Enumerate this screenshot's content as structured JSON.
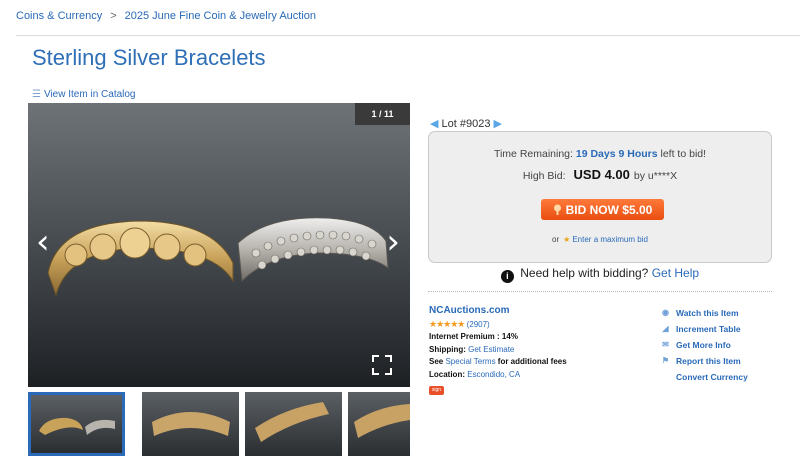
{
  "breadcrumb": {
    "items": [
      "Coins & Currency",
      "2025 June Fine Coin & Jewelry Auction"
    ],
    "separator": ">"
  },
  "title": "Sterling Silver Bracelets",
  "catalog_link": "View Item in Catalog",
  "gallery": {
    "counter": "1 / 11",
    "thumbnail_count": 4
  },
  "lot": {
    "label": "Lot #9023"
  },
  "bid": {
    "time_label": "Time Remaining:",
    "time_value": "19 Days 9 Hours",
    "time_suffix": "left to bid!",
    "high_label": "High Bid:",
    "high_amount": "USD 4.00",
    "high_by": "by u****X",
    "button_label": "BID NOW $5.00",
    "max_prefix": "or",
    "max_link": "Enter a maximum bid"
  },
  "help": {
    "text": "Need help with bidding?",
    "link": "Get Help"
  },
  "seller": {
    "name": "NCAuctions.com",
    "stars": "★★★★★",
    "rating_count": "(2907)",
    "premium_label": "Internet Premium :",
    "premium_value": "14%",
    "shipping_label": "Shipping:",
    "shipping_link": "Get Estimate",
    "terms_prefix": "See",
    "terms_link": "Special Terms",
    "terms_suffix": "for additional fees",
    "location_label": "Location:",
    "location_value": "Escondido, CA",
    "badge_text": "sign"
  },
  "actions": [
    {
      "label": "Watch this Item",
      "icon": "eye-icon"
    },
    {
      "label": "Increment Table",
      "icon": "chart-icon"
    },
    {
      "label": "Get More Info",
      "icon": "envelope-icon"
    },
    {
      "label": "Report this Item",
      "icon": "flag-icon"
    },
    {
      "label": "Convert Currency",
      "icon": ""
    }
  ],
  "colors": {
    "link": "#2a6ab8",
    "title": "#2e6fb7",
    "bid_button": "#e84e10",
    "stars": "#f39a1f"
  }
}
